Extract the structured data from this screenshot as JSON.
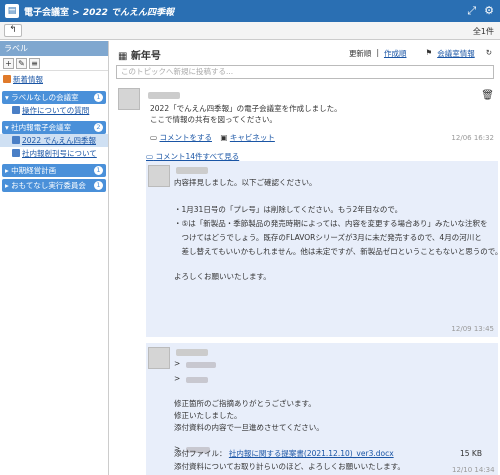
{
  "titlebar": {
    "app": "電子会議室",
    "separator": " > ",
    "room": "2022 でんえん四季報"
  },
  "subbar": {
    "count": "全1件"
  },
  "sidebar": {
    "header": "ラベル",
    "new_info": "新着情報",
    "groups": [
      {
        "label": "ラベルなしの会議室",
        "badge": "1",
        "children": [
          "操作についての質問"
        ]
      },
      {
        "label": "社内報電子会議室",
        "badge": "2",
        "children": [
          "2022 でんえん四季報",
          "社内報創刊号について"
        ]
      },
      {
        "label": "中期経営計画",
        "badge": "1",
        "children": []
      },
      {
        "label": "おもてなし実行委員会",
        "badge": "1",
        "children": []
      }
    ]
  },
  "topic": {
    "title": "新年号",
    "sort": "更新順",
    "separator": "|",
    "created_order": "作成順",
    "info": "会議室情報"
  },
  "post_input": {
    "placeholder": "このトピックへ新規に投稿する..."
  },
  "post": {
    "line1": "2022「でんえん四季報」の電子会議室を作成しました。",
    "line2": "ここで情報の共有を図ってください。",
    "comment_action": "コメントをする",
    "cabinet_action": "キャビネット",
    "timestamp": "12/06 16:32"
  },
  "comments_link": "コメント14件すべて見る",
  "comment1": {
    "lines": [
      "内容拝見しました。以下ご確認ください。",
      "",
      "・1月31日号の「プレ号」は削除してください。もう2年目なので。",
      "・⑤は「新製品・季節製品の発売時期によっては、内容を変更する場合あり」みたいな注釈を",
      "　つけてはどうでしょう。既存のFLAVORシリーズが3月に未だ発売するので、4月の河川と",
      "　差し替えてもいいかもしれません。他は未定ですが、新製品ゼロということもないと思うので。",
      "",
      "よろしくお願いいたします。"
    ],
    "timestamp": "12/09 13:45"
  },
  "comment2": {
    "quote1": ">",
    "quote2": ">",
    "line1": "修正箇所のご指摘ありがとうございます。",
    "line2": "修正いたしました。",
    "line3": "添付資料の内容で一旦進めさせてください。",
    "quote3": ">",
    "line4": "添付資料についてお取り計らいのほど、よろしくお願いいたします。",
    "attach_label": "添付ファイル：",
    "attach_file": "社内報に関する提案書(2021.12.10)_ver3.docx",
    "attach_size": "15 KB",
    "timestamp": "12/10 14:34"
  }
}
